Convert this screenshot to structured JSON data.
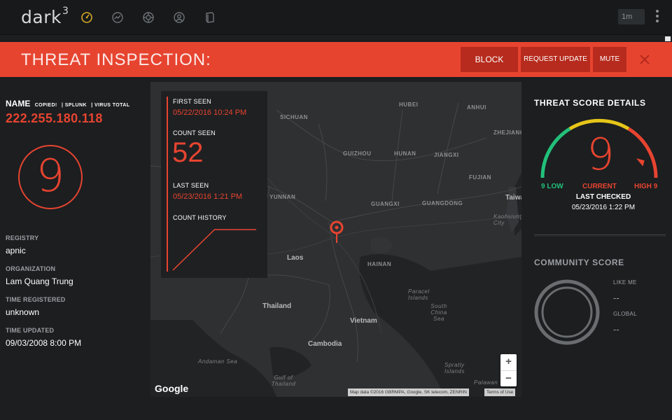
{
  "app": {
    "logo_text": "dark",
    "logo_sup": "3",
    "nav_icons": [
      "speedometer-icon",
      "trend-icon",
      "crosshair-icon",
      "user-icon",
      "book-icon"
    ],
    "range_select": "1m"
  },
  "banner": {
    "title": "THREAT INSPECTION:",
    "block_label": "BLOCK",
    "request_update_label": "REQUEST UPDATE",
    "mute_label": "MUTE",
    "color": "#e74430",
    "button_color": "#b62b1d"
  },
  "indicator": {
    "name_label": "NAME",
    "links": [
      "COPIED!",
      "| SPLUNK",
      "| VIRUS TOTAL"
    ],
    "ip": "222.255.180.118",
    "score": "9",
    "fields": [
      {
        "label": "REGISTRY",
        "value": "apnic"
      },
      {
        "label": "ORGANIZATION",
        "value": "Lam Quang Trung"
      },
      {
        "label": "TIME REGISTERED",
        "value": "unknown"
      },
      {
        "label": "TIME UPDATED",
        "value": "09/03/2008 8:00 PM"
      }
    ]
  },
  "map": {
    "labels": [
      "SICHUAN",
      "HUBEI",
      "ANHUI",
      "ZHEJIANG",
      "GUIZHOU",
      "HUNAN",
      "JIANGXI",
      "FUJIAN",
      "YUNNAN",
      "GUANGXI",
      "GUANGDONG",
      "HAINAN"
    ],
    "country_labels": [
      "Laos",
      "Thailand",
      "Vietnam",
      "Cambodia",
      "Taiwan",
      "Kaohsiung City"
    ],
    "sea_labels": [
      "Andaman Sea",
      "Gulf of Thailand",
      "Paracel Islands",
      "South China Sea",
      "Spratly Islands",
      "Palawan"
    ],
    "google_label": "Google",
    "attribution": "Map data ©2016 GBRMPA, Google, SK telecom, ZENRIN",
    "terms": "Terms of Use",
    "zoom_in": "+",
    "zoom_out": "−"
  },
  "overlay": {
    "first_seen_label": "FIRST SEEN",
    "first_seen": "05/22/2016 10:24 PM",
    "count_seen_label": "COUNT SEEN",
    "count_seen": "52",
    "last_seen_label": "LAST SEEN",
    "last_seen": "05/23/2016 1:21 PM",
    "count_history_label": "COUNT HISTORY",
    "count_history": [
      0,
      52,
      52
    ]
  },
  "threat_score": {
    "title": "THREAT SCORE DETAILS",
    "current": "9",
    "low_label": "9 LOW",
    "current_label": "CURRENT",
    "high_label": "HIGH 9",
    "last_checked_label": "LAST CHECKED",
    "last_checked": "05/23/2016 1:22 PM",
    "gauge_colors": [
      "#22c07a",
      "#e6c619",
      "#e74430"
    ]
  },
  "community": {
    "title": "COMMUNITY SCORE",
    "like_me_label": "LIKE ME",
    "like_me_value": "--",
    "global_label": "GLOBAL",
    "global_value": "--"
  }
}
